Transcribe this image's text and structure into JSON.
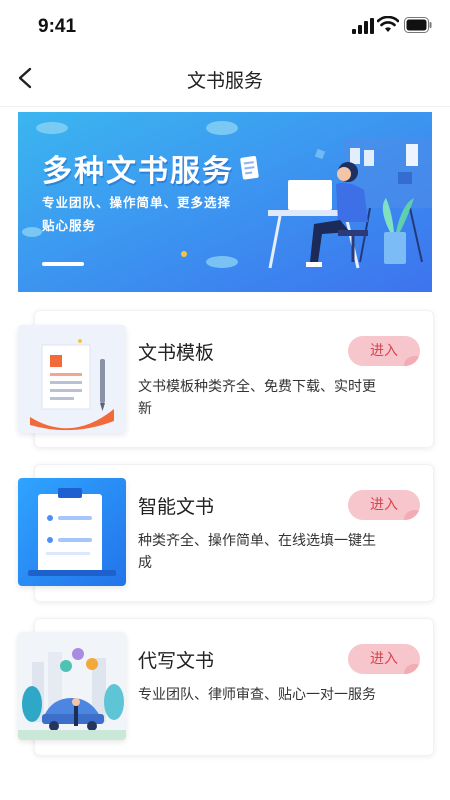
{
  "status_bar": {
    "time": "9:41"
  },
  "nav": {
    "title": "文书服务"
  },
  "banner": {
    "title": "多种文书服务",
    "subtitle_line1": "专业团队、操作简单、更多选择",
    "subtitle_line2": "贴心服务"
  },
  "services": [
    {
      "title": "文书模板",
      "desc": "文书模板种类齐全、免费下载、实时更新",
      "button": "进入",
      "icon": "document-template-illustration"
    },
    {
      "title": "智能文书",
      "desc": "种类齐全、操作简单、在线选填一键生成",
      "button": "进入",
      "icon": "clipboard-illustration"
    },
    {
      "title": "代写文书",
      "desc": "专业团队、律师审查、贴心一对一服务",
      "button": "进入",
      "icon": "city-car-illustration"
    }
  ],
  "colors": {
    "accent": "#3d7cf2",
    "button_bg": "#f6c6cc",
    "button_text": "#d6474f"
  }
}
